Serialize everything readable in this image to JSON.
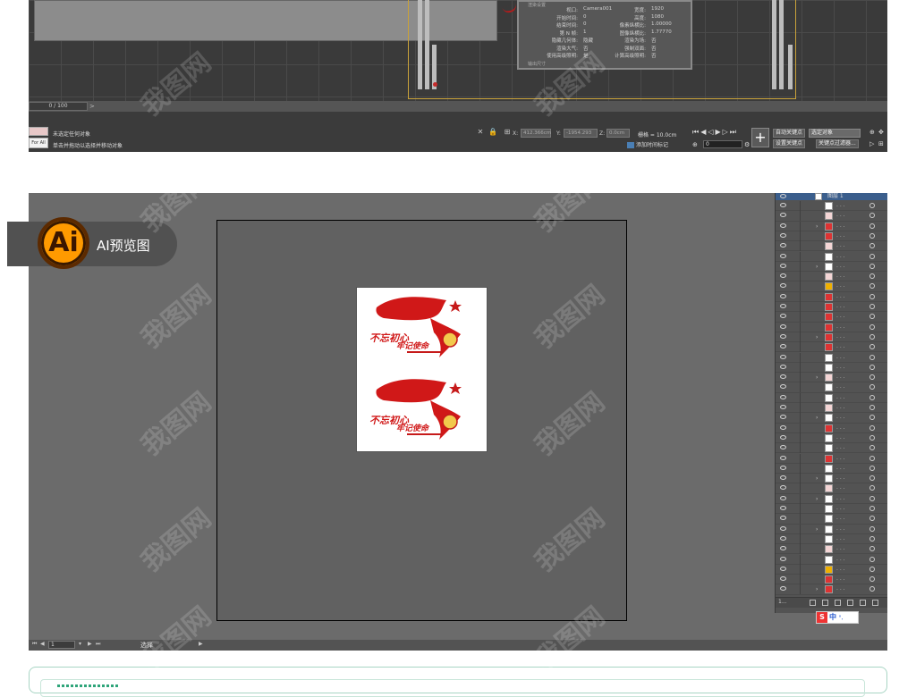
{
  "max": {
    "timeline_value": "0 / 100",
    "render_info": {
      "header": "渲染设置",
      "rows": [
        {
          "k1": "视口:",
          "v1": "Camera001",
          "k2": "宽度:",
          "v2": "1920"
        },
        {
          "k1": "开始时间:",
          "v1": "0",
          "k2": "高度:",
          "v2": "1080"
        },
        {
          "k1": "结束时间:",
          "v1": "0",
          "k2": "像素纵横比:",
          "v2": "1.00000"
        },
        {
          "k1": "第 N 帧:",
          "v1": "1",
          "k2": "图像纵横比:",
          "v2": "1.77770"
        },
        {
          "k1": "隐藏几何体:",
          "v1": "隐藏",
          "k2": "渲染为场:",
          "v2": "否"
        },
        {
          "k1": "渲染大气:",
          "v1": "否",
          "k2": "强制双面:",
          "v2": "否"
        },
        {
          "k1": "使用高级照明:",
          "v1": "是",
          "k2": "计算高级照明:",
          "v2": "否"
        }
      ],
      "extra": "输出尺寸"
    },
    "status": {
      "selection": "未选定任何对象",
      "prompt": "单击并拖动以选择并移动对象",
      "maxscript_label": "For All",
      "x_label": "X:",
      "x_value": "412.366cm",
      "y_label": "Y:",
      "y_value": "-1954.293",
      "z_label": "Z:",
      "z_value": "0.0cm",
      "grid": "栅格 = 10.0cm",
      "add_time_tag": "添加时间标记",
      "frame": "0",
      "auto_key": "自动关键点",
      "set_key": "设置关键点",
      "selected_object": "选定对象",
      "key_filter": "关键点过滤器..."
    }
  },
  "ai": {
    "badge_logo": "Ai",
    "badge_label": "AI预览图",
    "layer_name": "图层 1",
    "layer_count": "1...",
    "zoom": "1",
    "tool": "选择",
    "ime_s": "S",
    "ime_lang": "中",
    "ime_extra": "°,",
    "poster_line1": "不忘初心",
    "poster_line2": "牢记使命"
  },
  "watermark": "我图网"
}
